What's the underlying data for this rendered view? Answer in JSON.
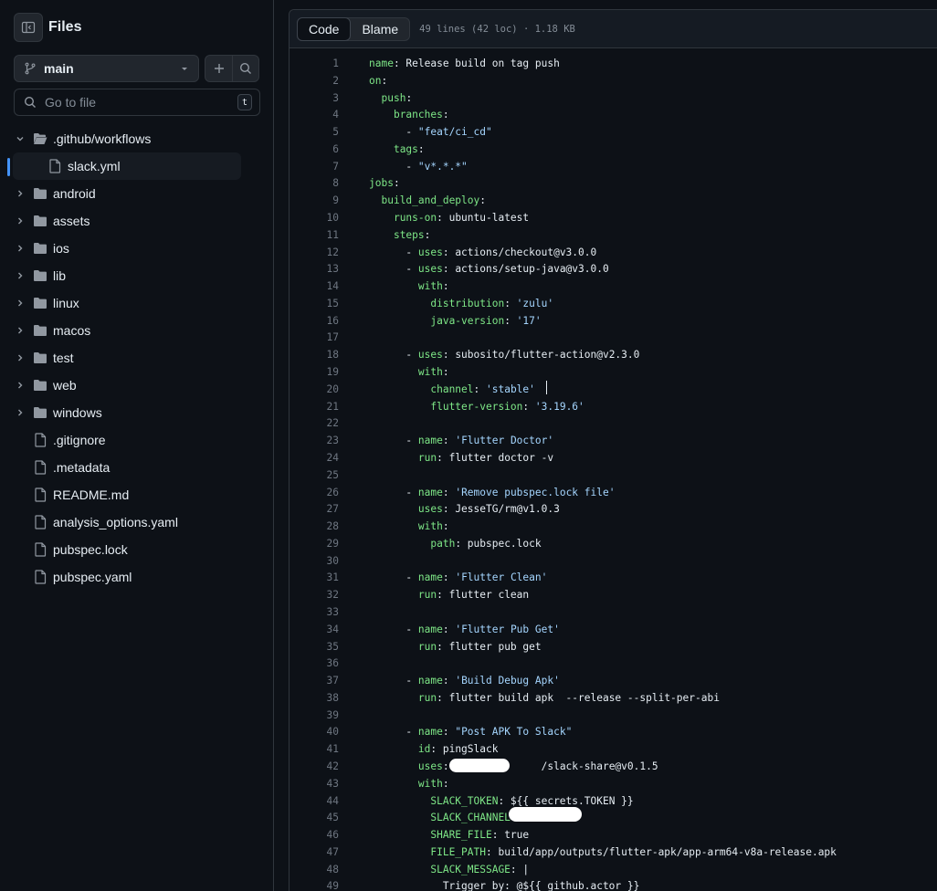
{
  "sidebar": {
    "title": "Files",
    "branch": "main",
    "goto_placeholder": "Go to file",
    "shortcut_key": "t",
    "items": [
      {
        "type": "folder",
        "expanded": true,
        "label": ".github/workflows"
      },
      {
        "type": "file",
        "label": "slack.yml",
        "selected": true,
        "indent": 1
      },
      {
        "type": "folder",
        "label": "android"
      },
      {
        "type": "folder",
        "label": "assets"
      },
      {
        "type": "folder",
        "label": "ios"
      },
      {
        "type": "folder",
        "label": "lib"
      },
      {
        "type": "folder",
        "label": "linux"
      },
      {
        "type": "folder",
        "label": "macos"
      },
      {
        "type": "folder",
        "label": "test"
      },
      {
        "type": "folder",
        "label": "web"
      },
      {
        "type": "folder",
        "label": "windows"
      },
      {
        "type": "file",
        "label": ".gitignore"
      },
      {
        "type": "file",
        "label": ".metadata"
      },
      {
        "type": "file",
        "label": "README.md"
      },
      {
        "type": "file",
        "label": "analysis_options.yaml"
      },
      {
        "type": "file",
        "label": "pubspec.lock"
      },
      {
        "type": "file",
        "label": "pubspec.yaml"
      }
    ]
  },
  "viewer": {
    "tab_code": "Code",
    "tab_blame": "Blame",
    "meta": "49 lines (42 loc) · 1.18 KB"
  },
  "code_lines": [
    "name: Release build on tag push",
    "on:",
    "  push:",
    "    branches:",
    "      - \"feat/ci_cd\"",
    "    tags:",
    "      - \"v*.*.*\"",
    "jobs:",
    "  build_and_deploy:",
    "    runs-on: ubuntu-latest",
    "    steps:",
    "      - uses: actions/checkout@v3.0.0",
    "      - uses: actions/setup-java@v3.0.0",
    "        with:",
    "          distribution: 'zulu'",
    "          java-version: '17'",
    "",
    "      - uses: subosito/flutter-action@v2.3.0",
    "        with:",
    "          channel: 'stable'",
    "          flutter-version: '3.19.6'",
    "",
    "      - name: 'Flutter Doctor'",
    "        run: flutter doctor -v",
    "",
    "      - name: 'Remove pubspec.lock file'",
    "        uses: JesseTG/rm@v1.0.3",
    "        with:",
    "          path: pubspec.lock",
    "",
    "      - name: 'Flutter Clean'",
    "        run: flutter clean",
    "",
    "      - name: 'Flutter Pub Get'",
    "        run: flutter pub get",
    "",
    "      - name: 'Build Debug Apk'",
    "        run: flutter build apk  --release --split-per-abi",
    "",
    "      - name: \"Post APK To Slack\"",
    "        id: pingSlack",
    "        uses:               /slack-share@v0.1.5",
    "        with:",
    "          SLACK_TOKEN: ${{ secrets.TOKEN }}",
    "          SLACK_CHANNEL: ",
    "          SHARE_FILE: true",
    "          FILE_PATH: build/app/outputs/flutter-apk/app-arm64-v8a-release.apk",
    "          SLACK_MESSAGE: |",
    "            Trigger by: @${{ github.actor }}"
  ]
}
